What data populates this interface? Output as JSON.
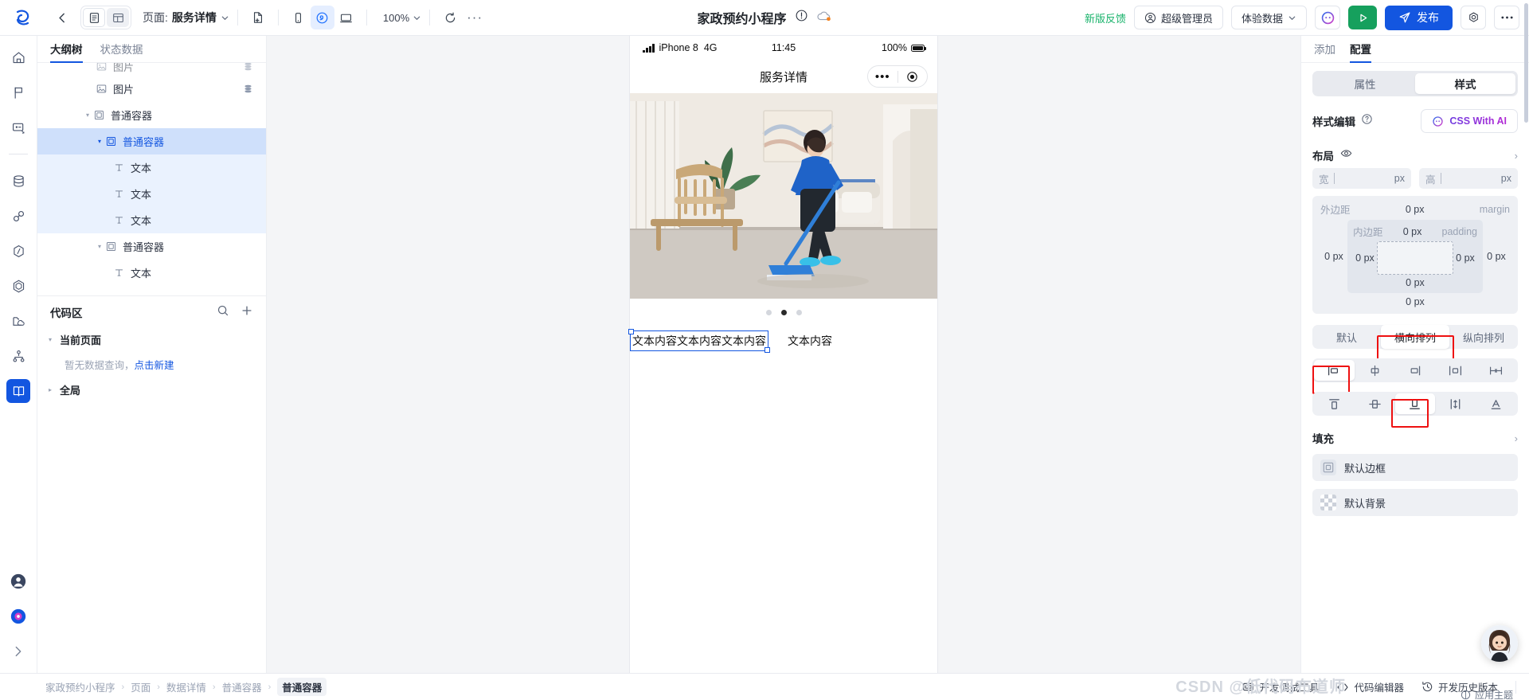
{
  "topbar": {
    "back_label": "←",
    "page_prefix": "页面:",
    "page_name": "服务详情",
    "zoom": "100%",
    "more": "···",
    "app_title": "家政预约小程序",
    "feedback": "新版反馈",
    "role": "超级管理员",
    "data_mode": "体验数据",
    "publish": "发布",
    "icons": {
      "view_doc": "doc-view-icon",
      "view_grid": "grid-view-icon",
      "new_page": "new-page-icon",
      "mobile": "mobile-preview-icon",
      "mini": "miniprogram-preview-icon",
      "desktop": "desktop-preview-icon",
      "refresh": "refresh-icon",
      "warning": "warning-circle-icon",
      "cloud": "cloud-sync-icon",
      "avatar": "user-avatar-icon",
      "chat": "ai-chat-icon",
      "run": "run-preview-icon",
      "send": "send-publish-icon",
      "settings": "settings-gear-icon",
      "overflow": "overflow-dots-icon"
    }
  },
  "rail": {
    "items": [
      {
        "name": "home-icon",
        "label": "首页"
      },
      {
        "name": "flag-icon",
        "label": "流程"
      },
      {
        "name": "page-card-icon",
        "label": "页面"
      },
      {
        "name": "database-icon",
        "label": "数据源"
      },
      {
        "name": "link-icon",
        "label": "连接器"
      },
      {
        "name": "slash-hex-icon",
        "label": "变量"
      },
      {
        "name": "hexagon-icon",
        "label": "组件"
      },
      {
        "name": "folder-cloud-icon",
        "label": "资源"
      },
      {
        "name": "sitemap-icon",
        "label": "结构"
      },
      {
        "name": "users-icon",
        "label": "用户"
      },
      {
        "name": "book-icon",
        "label": "手册"
      }
    ],
    "bottom": [
      {
        "name": "account-icon",
        "label": "账户"
      },
      {
        "name": "help-icon",
        "label": "帮助"
      },
      {
        "name": "collapse-icon",
        "label": "展开"
      }
    ]
  },
  "left_panel": {
    "tabs": [
      {
        "label": "大纲树",
        "active": true
      },
      {
        "label": "状态数据",
        "active": false
      }
    ],
    "tree": [
      {
        "label": "图片",
        "indent": 3,
        "icon": "image-icon",
        "caret": "",
        "state": "clipped",
        "stack": true
      },
      {
        "label": "图片",
        "indent": 3,
        "icon": "image-icon",
        "caret": "",
        "state": "normal",
        "stack": true
      },
      {
        "label": "普通容器",
        "indent": 2,
        "icon": "container-icon",
        "caret": "▾",
        "state": "normal",
        "stack": false
      },
      {
        "label": "普通容器",
        "indent": 3,
        "icon": "container-icon",
        "caret": "▾",
        "state": "selected",
        "stack": false
      },
      {
        "label": "文本",
        "indent": 4,
        "icon": "text-icon",
        "caret": "",
        "state": "inbox",
        "stack": false
      },
      {
        "label": "文本",
        "indent": 4,
        "icon": "text-icon",
        "caret": "",
        "state": "inbox",
        "stack": false
      },
      {
        "label": "文本",
        "indent": 4,
        "icon": "text-icon",
        "caret": "",
        "state": "inbox",
        "stack": false
      },
      {
        "label": "普通容器",
        "indent": 3,
        "icon": "container-icon",
        "caret": "▾",
        "state": "normal",
        "stack": false
      },
      {
        "label": "文本",
        "indent": 4,
        "icon": "text-icon",
        "caret": "",
        "state": "normal",
        "stack": false
      }
    ],
    "code_area": {
      "title": "代码区",
      "search_icon": "search-icon",
      "add_icon": "plus-icon",
      "groups": [
        {
          "label": "当前页面",
          "caret": "▾",
          "empty_text": "暂无数据查询，",
          "empty_link": "点击新建"
        },
        {
          "label": "全局",
          "caret": "▸"
        }
      ]
    }
  },
  "phone": {
    "device": "iPhone 8",
    "network": "4G",
    "time": "11:45",
    "battery": "100%",
    "nav_title": "服务详情",
    "capsule_more": "•••",
    "capsule_target": "target-icon",
    "carousel_dots": 3,
    "carousel_active_index": 1,
    "text_selected": "文本内容文本内容文本内容",
    "text_plain": "文本内容"
  },
  "right_panel": {
    "tabs": [
      {
        "label": "添加",
        "active": false
      },
      {
        "label": "配置",
        "active": true
      }
    ],
    "prop_style_seg": [
      {
        "label": "属性",
        "active": false
      },
      {
        "label": "样式",
        "active": true
      }
    ],
    "style_edit_label": "样式编辑",
    "help_icon": "question-circle-icon",
    "css_ai_label": "CSS With AI",
    "layout": {
      "title": "布局",
      "eye_icon": "eye-icon",
      "chevron": "›",
      "width_label": "宽",
      "height_label": "高",
      "unit": "px",
      "margin_label": "外边距",
      "margin_en": "margin",
      "padding_label": "内边距",
      "padding_en": "padding",
      "margin_top": "0 px",
      "margin_left": "0 px",
      "margin_right": "0 px",
      "margin_bottom": "0 px",
      "padding_top": "0 px",
      "padding_left": "0 px",
      "padding_right": "0 px",
      "padding_bottom": "0 px"
    },
    "direction": [
      {
        "label": "默认",
        "active": false,
        "highlight": false
      },
      {
        "label": "横向排列",
        "active": true,
        "highlight": true
      },
      {
        "label": "纵向排列",
        "active": false,
        "highlight": false
      }
    ],
    "align_h": [
      {
        "name": "align-left-icon",
        "active": true,
        "highlight": true
      },
      {
        "name": "align-center-icon",
        "active": false,
        "highlight": false
      },
      {
        "name": "align-right-icon",
        "active": false,
        "highlight": false
      },
      {
        "name": "align-space-between-icon",
        "active": false,
        "highlight": false
      },
      {
        "name": "align-space-around-icon",
        "active": false,
        "highlight": false
      }
    ],
    "align_v": [
      {
        "name": "align-top-icon",
        "active": false,
        "highlight": false
      },
      {
        "name": "align-middle-icon",
        "active": false,
        "highlight": false
      },
      {
        "name": "align-bottom-icon",
        "active": true,
        "highlight": true
      },
      {
        "name": "align-stretch-icon",
        "active": false,
        "highlight": false
      },
      {
        "name": "align-baseline-icon",
        "active": false,
        "highlight": false
      }
    ],
    "fill": {
      "title": "填充",
      "chevron": "›",
      "items": [
        {
          "label": "默认边框",
          "swatch": "border-swatch"
        },
        {
          "label": "默认背景",
          "swatch": "checker-swatch"
        }
      ]
    }
  },
  "footer": {
    "breadcrumb": [
      "家政预约小程序",
      "页面",
      "数据详情",
      "普通容器",
      "普通容器"
    ],
    "separator": "›",
    "tools": [
      {
        "label": "开发调试工具",
        "icon": "debug-tool-icon"
      },
      {
        "label": "代码编辑器",
        "icon": "code-editor-icon"
      },
      {
        "label": "开发历史版本",
        "icon": "history-icon"
      }
    ],
    "apply_theme": "应用主题",
    "watermark": "CSDN @低代码布道师"
  }
}
